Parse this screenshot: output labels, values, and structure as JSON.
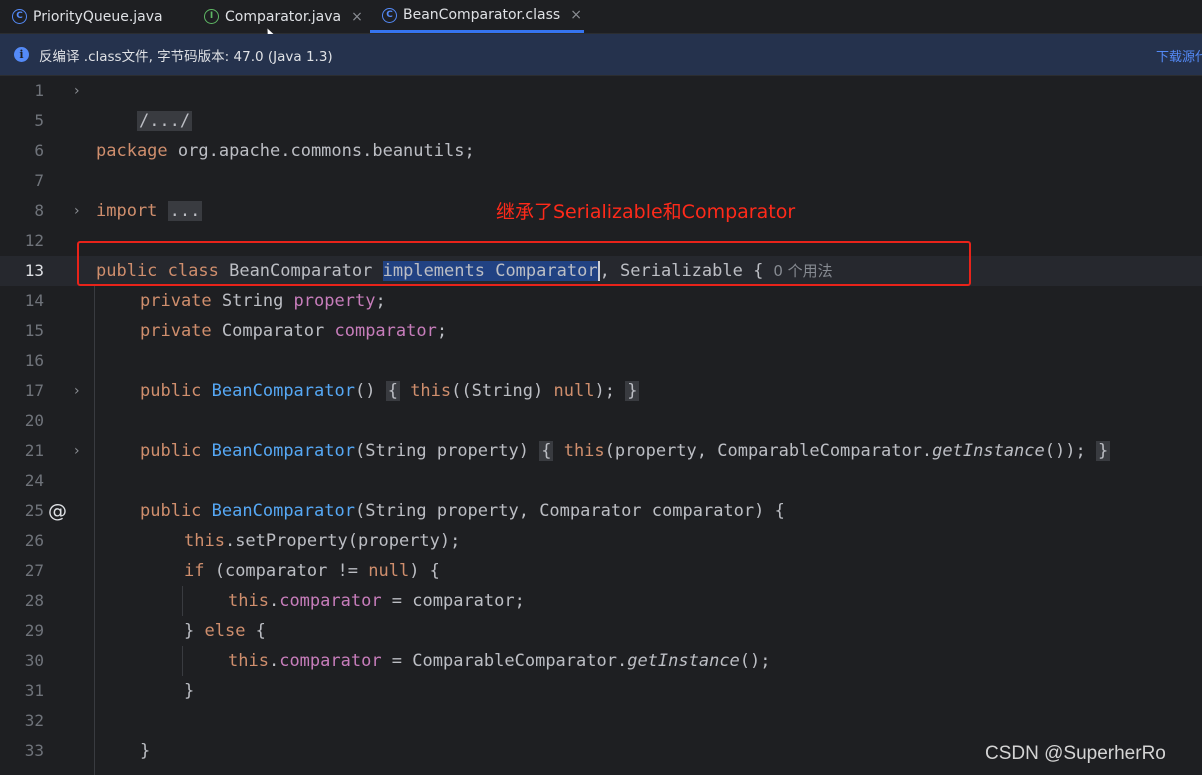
{
  "tabs": [
    {
      "icon_letter": "C",
      "label": "PriorityQueue.java",
      "icon": "class-icon",
      "closable": false
    },
    {
      "icon_letter": "I",
      "label": "Comparator.java",
      "icon": "interface-icon",
      "closable": true
    },
    {
      "icon_letter": "C",
      "label": "BeanComparator.class",
      "icon": "class-icon",
      "closable": true,
      "active": true
    }
  ],
  "tab_close_glyph": "×",
  "banner": {
    "info_glyph": "i",
    "text": "反编译 .class文件, 字节码版本: 47.0 (Java 1.3)",
    "link": "下载源代码"
  },
  "gutter": {
    "line_numbers": [
      "1",
      "5",
      "6",
      "7",
      "8",
      "12",
      "13",
      "14",
      "15",
      "16",
      "17",
      "20",
      "21",
      "24",
      "25",
      "26",
      "27",
      "28",
      "29",
      "30",
      "31",
      "32",
      "33"
    ],
    "current_line": "13",
    "fold_glyph": "›",
    "override_marker": "@"
  },
  "code": {
    "l1_fold": "/.../",
    "l6_kw": "package",
    "l6_rest": " org.apache.commons.beanutils;",
    "l8_kw": "import",
    "l8_fold": "...",
    "l13_kw1": "public",
    "l13_kw2": "class",
    "l13_name": " BeanComparator ",
    "l13_sel": "implements Comparator",
    "l13_rest": ", Serializable {",
    "l13_hint": "0 个用法",
    "l14_kw": "private",
    "l14_type": " String ",
    "l14_field": "property",
    "l14_end": ";",
    "l15_kw": "private",
    "l15_type": " Comparator ",
    "l15_field": "comparator",
    "l15_end": ";",
    "l17_kw": "public",
    "l17_fn": "BeanComparator",
    "l17_args": "() ",
    "l17_open": "{",
    "l17_this": "this",
    "l17_mid": "((String) ",
    "l17_null": "null",
    "l17_end": ");",
    "l17_close": "}",
    "l21_kw": "public",
    "l21_fn": "BeanComparator",
    "l21_args": "(String property) ",
    "l21_open": "{",
    "l21_this": "this",
    "l21_mid": "(property, ComparableComparator.",
    "l21_call": "getInstance",
    "l21_end": "());",
    "l21_close": "}",
    "l25_kw": "public",
    "l25_fn": "BeanComparator",
    "l25_args": "(String property, Comparator comparator) {",
    "l26_this": "this",
    "l26_rest": ".setProperty(property);",
    "l27_kw": "if",
    "l27_mid": " (comparator != ",
    "l27_null": "null",
    "l27_end": ") {",
    "l28_this": "this",
    "l28_dot": ".",
    "l28_field": "comparator",
    "l28_rest": " = comparator;",
    "l29_open": "} ",
    "l29_kw": "else",
    "l29_end": " {",
    "l30_this": "this",
    "l30_dot": ".",
    "l30_field": "comparator",
    "l30_rest": " = ComparableComparator.",
    "l30_call": "getInstance",
    "l30_end": "();",
    "l31": "}",
    "l33": "}"
  },
  "annotation": {
    "text": "继承了Serializable和Comparator",
    "color": "#e8231a"
  },
  "watermark": "CSDN @SuperherRo"
}
